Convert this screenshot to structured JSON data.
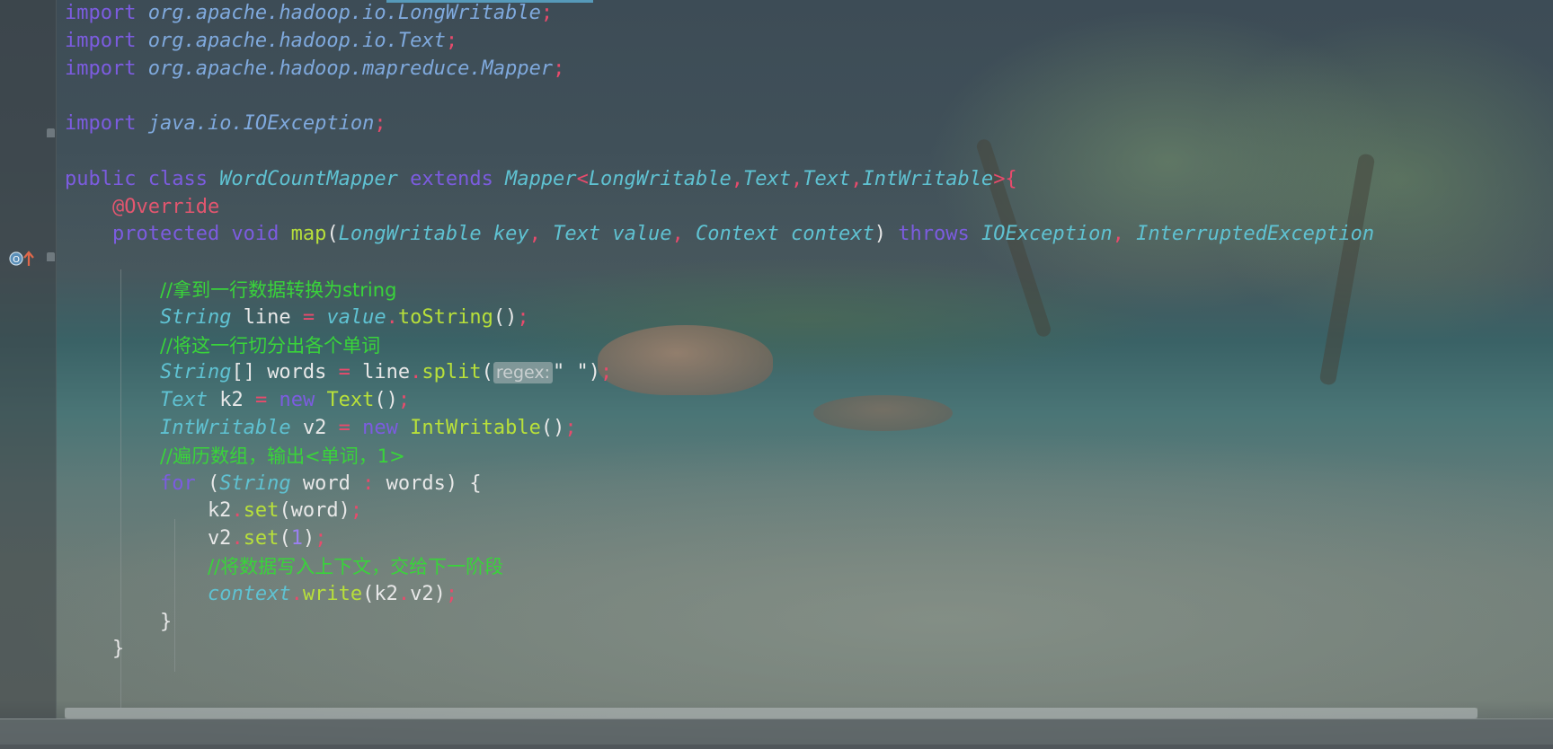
{
  "gutter": {
    "override_icon": "override-method-icon"
  },
  "code_lines": [
    [
      [
        "kw",
        "import "
      ],
      [
        "pk",
        "org.apache.hadoop.io.LongWritable"
      ],
      [
        "pu",
        ";"
      ]
    ],
    [
      [
        "kw",
        "import "
      ],
      [
        "pk",
        "org.apache.hadoop.io.Text"
      ],
      [
        "pu",
        ";"
      ]
    ],
    [
      [
        "kw",
        "import "
      ],
      [
        "pk",
        "org.apache.hadoop.mapreduce.Mapper"
      ],
      [
        "pu",
        ";"
      ]
    ],
    [],
    [
      [
        "kw",
        "import "
      ],
      [
        "pk",
        "java.io.IOException"
      ],
      [
        "pu",
        ";"
      ]
    ],
    [],
    [
      [
        "kw",
        "public class "
      ],
      [
        "ty",
        "WordCountMapper "
      ],
      [
        "kw",
        "extends "
      ],
      [
        "ty",
        "Mapper"
      ],
      [
        "pu",
        "<"
      ],
      [
        "ty",
        "LongWritable"
      ],
      [
        "pu",
        ","
      ],
      [
        "ty",
        "Text"
      ],
      [
        "pu",
        ","
      ],
      [
        "ty",
        "Text"
      ],
      [
        "pu",
        ","
      ],
      [
        "ty",
        "IntWritable"
      ],
      [
        "pu",
        ">{"
      ]
    ],
    [
      [
        "tx",
        "    "
      ],
      [
        "an",
        "@Override"
      ]
    ],
    [
      [
        "tx",
        "    "
      ],
      [
        "kw",
        "protected void "
      ],
      [
        "fn",
        "map"
      ],
      [
        "tx",
        "("
      ],
      [
        "ty",
        "LongWritable key"
      ],
      [
        "pu",
        ", "
      ],
      [
        "ty",
        "Text value"
      ],
      [
        "pu",
        ", "
      ],
      [
        "ty",
        "Context context"
      ],
      [
        "tx",
        ") "
      ],
      [
        "kw",
        "throws "
      ],
      [
        "ty",
        "IOException"
      ],
      [
        "pu",
        ", "
      ],
      [
        "ty",
        "InterruptedException"
      ]
    ],
    [],
    [
      [
        "tx",
        "        "
      ],
      [
        "cm",
        "//拿到一行数据转换为string"
      ]
    ],
    [
      [
        "tx",
        "        "
      ],
      [
        "ty",
        "String "
      ],
      [
        "tx",
        "line "
      ],
      [
        "pu",
        "= "
      ],
      [
        "ty",
        "value"
      ],
      [
        "pu",
        "."
      ],
      [
        "fn",
        "toString"
      ],
      [
        "tx",
        "()"
      ],
      [
        "pu",
        ";"
      ]
    ],
    [
      [
        "tx",
        "        "
      ],
      [
        "cm",
        "//将这一行切分出各个单词"
      ]
    ],
    [
      [
        "tx",
        "        "
      ],
      [
        "ty",
        "String"
      ],
      [
        "tx",
        "[] words "
      ],
      [
        "pu",
        "= "
      ],
      [
        "tx",
        "line"
      ],
      [
        "pu",
        "."
      ],
      [
        "fn",
        "split"
      ],
      [
        "tx",
        "("
      ],
      [
        "hint",
        "regex:"
      ],
      [
        "st",
        "\" \""
      ],
      [
        "tx",
        ")"
      ],
      [
        "pu",
        ";"
      ]
    ],
    [
      [
        "tx",
        "        "
      ],
      [
        "ty",
        "Text "
      ],
      [
        "tx",
        "k2 "
      ],
      [
        "pu",
        "= "
      ],
      [
        "kw",
        "new "
      ],
      [
        "fn",
        "Text"
      ],
      [
        "tx",
        "()"
      ],
      [
        "pu",
        ";"
      ]
    ],
    [
      [
        "tx",
        "        "
      ],
      [
        "ty",
        "IntWritable "
      ],
      [
        "tx",
        "v2 "
      ],
      [
        "pu",
        "= "
      ],
      [
        "kw",
        "new "
      ],
      [
        "fn",
        "IntWritable"
      ],
      [
        "tx",
        "()"
      ],
      [
        "pu",
        ";"
      ]
    ],
    [
      [
        "tx",
        "        "
      ],
      [
        "cm",
        "//遍历数组，输出<单词，1>"
      ]
    ],
    [
      [
        "tx",
        "        "
      ],
      [
        "kw",
        "for "
      ],
      [
        "tx",
        "("
      ],
      [
        "ty",
        "String "
      ],
      [
        "tx",
        "word "
      ],
      [
        "pu",
        ": "
      ],
      [
        "tx",
        "words) {"
      ]
    ],
    [
      [
        "tx",
        "            k2"
      ],
      [
        "pu",
        "."
      ],
      [
        "fn",
        "set"
      ],
      [
        "tx",
        "(word)"
      ],
      [
        "pu",
        ";"
      ]
    ],
    [
      [
        "tx",
        "            v2"
      ],
      [
        "pu",
        "."
      ],
      [
        "fn",
        "set"
      ],
      [
        "tx",
        "("
      ],
      [
        "nu",
        "1"
      ],
      [
        "tx",
        ")"
      ],
      [
        "pu",
        ";"
      ]
    ],
    [
      [
        "tx",
        "            "
      ],
      [
        "cm",
        "//将数据写入上下文，交给下一阶段"
      ]
    ],
    [
      [
        "tx",
        "            "
      ],
      [
        "ty",
        "context"
      ],
      [
        "pu",
        "."
      ],
      [
        "fn",
        "write"
      ],
      [
        "tx",
        "(k2"
      ],
      [
        "pu",
        "."
      ],
      [
        "tx",
        "v2)"
      ],
      [
        "pu",
        ";"
      ]
    ],
    [
      [
        "tx",
        "        }"
      ]
    ],
    [
      [
        "tx",
        "    }"
      ]
    ]
  ]
}
